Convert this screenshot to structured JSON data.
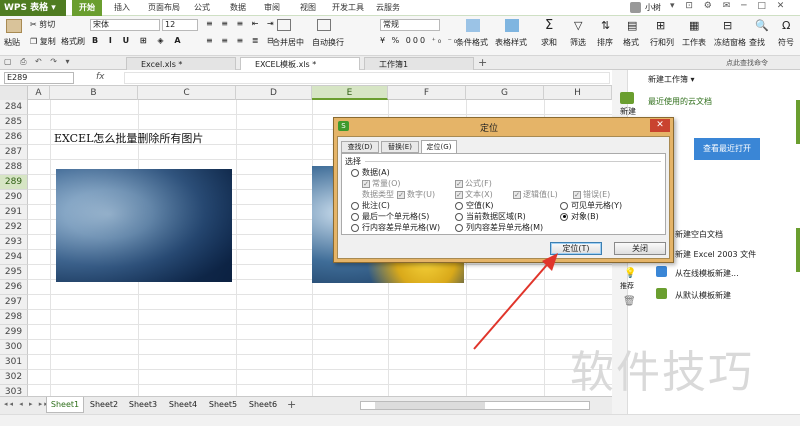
{
  "app": {
    "name": "WPS 表格",
    "user": "小树"
  },
  "menu_tabs": [
    "开始",
    "插入",
    "页面布局",
    "公式",
    "数据",
    "审阅",
    "视图",
    "开发工具",
    "云服务"
  ],
  "ribbon": {
    "paste": "粘贴",
    "cut": "剪切",
    "copy": "复制",
    "format_painter": "格式刷",
    "font_name": "宋体",
    "font_size": "12",
    "merge_center": "合并居中",
    "wrap_text": "自动换行",
    "number_format": "常规",
    "cond_format": "条件格式",
    "table_style": "表格样式",
    "sum": "求和",
    "filter": "筛选",
    "sort": "排序",
    "format": "格式",
    "rows_cols": "行和列",
    "worksheet": "工作表",
    "freeze": "冻结窗格",
    "find": "查找",
    "symbol": "符号"
  },
  "doc_tabs": [
    {
      "label": "Excel.xls *",
      "active": false
    },
    {
      "label": "EXCEL模板.xls *",
      "active": true
    },
    {
      "label": "工作簿1",
      "active": false
    }
  ],
  "formula_bar": {
    "cell_ref": "E289",
    "fx": "fx",
    "content": ""
  },
  "columns": [
    "A",
    "B",
    "C",
    "D",
    "E",
    "F",
    "G",
    "H"
  ],
  "rows": [
    "284",
    "285",
    "286",
    "287",
    "288",
    "289",
    "290",
    "291",
    "292",
    "293",
    "294",
    "295",
    "296",
    "297",
    "298",
    "299",
    "300",
    "301",
    "302",
    "303",
    "304"
  ],
  "active_row": "289",
  "active_col": "E",
  "sheet_title": "EXCEL怎么批量删除所有图片",
  "sheet_tabs": [
    "Sheet1",
    "Sheet2",
    "Sheet3",
    "Sheet4",
    "Sheet5",
    "Sheet6"
  ],
  "active_sheet": "Sheet1",
  "right_panel": {
    "title": "新建工作簿",
    "new_label": "新建",
    "recent_cloud": "最近使用的云文档",
    "view_recent_button": "查看最近打开",
    "items": [
      "新建空白文档",
      "新建 Excel 2003 文件",
      "从在线模板新建...",
      "从默认模板新建"
    ],
    "recommend": "推荐",
    "topright": "点此查找命令"
  },
  "dialog": {
    "title": "定位",
    "tabs": [
      "查找(D)",
      "替换(E)",
      "定位(G)"
    ],
    "active_tab": "定位(G)",
    "group_label": "选择",
    "data_option": "数据(A)",
    "sub_checks_row1": [
      "常量(O)",
      "公式(F)"
    ],
    "data_type_label": "数据类型",
    "sub_checks_row2": [
      "数字(U)",
      "文本(X)",
      "逻辑值(L)",
      "错误(E)"
    ],
    "options": [
      [
        "批注(C)",
        "空值(K)",
        "可见单元格(Y)"
      ],
      [
        "最后一个单元格(S)",
        "当前数据区域(R)",
        "对象(B)"
      ],
      [
        "行内容差异单元格(W)",
        "列内容差异单元格(M)",
        ""
      ]
    ],
    "selected_option": "对象(B)",
    "ok_button": "定位(T)",
    "close_button": "关闭"
  },
  "watermark": "软件技巧",
  "colors": {
    "accent": "#6a9e2f",
    "dialog_frame": "#e5b468",
    "arrow": "#e0352b"
  }
}
